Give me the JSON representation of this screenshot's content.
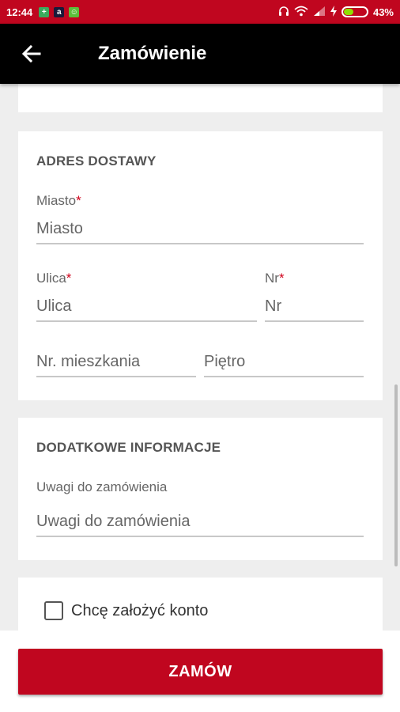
{
  "status_bar": {
    "time": "12:44",
    "battery": "43%",
    "battery_level": 0.43,
    "icons": [
      "notification-icon",
      "app-icon",
      "message-icon",
      "headphones-icon",
      "wifi-icon",
      "signal-icon",
      "charging-icon"
    ]
  },
  "toolbar": {
    "back_icon": "arrow-left-icon",
    "title": "Zamówienie"
  },
  "address_section": {
    "title": "ADRES DOSTAWY",
    "city_label": "Miasto",
    "city_placeholder": "Miasto",
    "street_label": "Ulica",
    "street_placeholder": "Ulica",
    "number_label": "Nr",
    "number_placeholder": "Nr",
    "apartment_placeholder": "Nr. mieszkania",
    "floor_placeholder": "Piętro",
    "required_mark": "*"
  },
  "info_section": {
    "title": "DODATKOWE INFORMACJE",
    "notes_label": "Uwagi do zamówienia",
    "notes_placeholder": "Uwagi do zamówienia"
  },
  "account_section": {
    "create_account_label": "Chcę założyć konto",
    "checked": false
  },
  "order_button": {
    "label": "ZAMÓW"
  },
  "colors": {
    "accent": "#c0061f",
    "toolbar": "#000000",
    "background": "#eeeeee"
  }
}
